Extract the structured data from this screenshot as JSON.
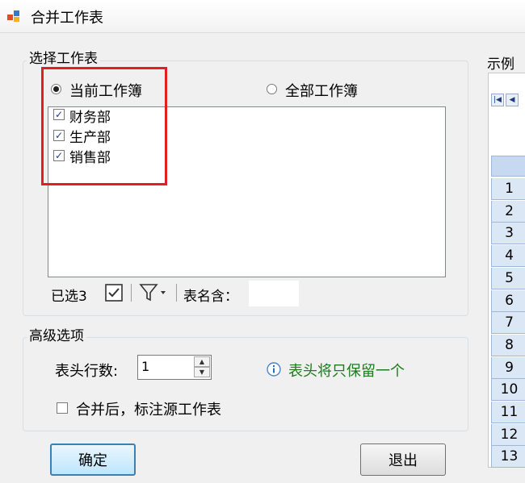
{
  "window": {
    "title": "合并工作表"
  },
  "select_group": {
    "label": "选择工作表",
    "scope_options": [
      {
        "label": "当前工作簿",
        "selected": true
      },
      {
        "label": "全部工作簿",
        "selected": false
      }
    ],
    "sheets": [
      {
        "name": "财务部",
        "checked": true
      },
      {
        "name": "生产部",
        "checked": true
      },
      {
        "name": "销售部",
        "checked": true
      }
    ],
    "footer": {
      "selected_count": "已选3",
      "check_all_icon": "checkbox-icon",
      "filter_icon": "filter-icon",
      "name_contains_label": "表名含：",
      "name_contains_value": ""
    }
  },
  "advanced_group": {
    "label": "高级选项",
    "header_rows_label": "表头行数:",
    "header_rows_value": "1",
    "info_icon": "info-icon",
    "info_text": "表头将只保留一个",
    "mark_source_label": "合并后，标注源工作表",
    "mark_source_checked": false
  },
  "buttons": {
    "ok": "确定",
    "exit": "退出"
  },
  "sample": {
    "label": "示例",
    "row_headers": [
      "1",
      "2",
      "3",
      "4",
      "5",
      "6",
      "7",
      "8",
      "9",
      "10",
      "11",
      "12",
      "13"
    ]
  },
  "colors": {
    "highlight_border": "#e02020",
    "info_text": "#1f7a1f",
    "accent": "#3c7fb1"
  }
}
